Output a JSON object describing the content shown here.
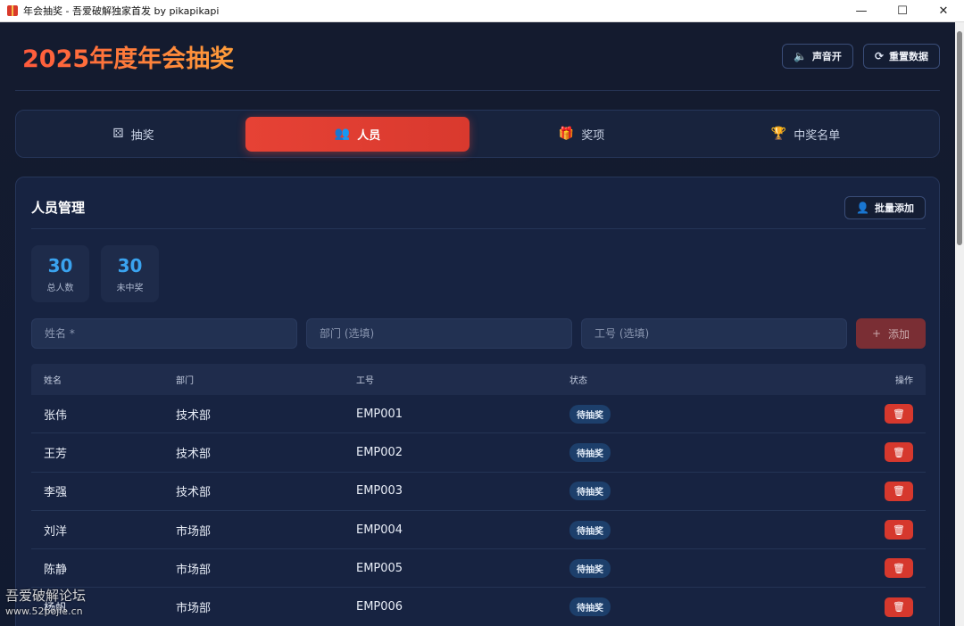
{
  "window": {
    "title": "年会抽奖 - 吾爱破解独家首发 by pikapikapi",
    "minimize": "—",
    "maximize": "☐",
    "close": "✕"
  },
  "header": {
    "title": "2025年度年会抽奖",
    "sound_button": "声音开",
    "reset_button": "重置数据"
  },
  "tabs": [
    {
      "label": "抽奖",
      "icon": "dice-icon",
      "active": false
    },
    {
      "label": "人员",
      "icon": "users-icon",
      "active": true
    },
    {
      "label": "奖项",
      "icon": "gift-icon",
      "active": false
    },
    {
      "label": "中奖名单",
      "icon": "trophy-icon",
      "active": false
    }
  ],
  "panel": {
    "title": "人员管理",
    "batch_add_button": "批量添加",
    "stats": [
      {
        "value": "30",
        "label": "总人数"
      },
      {
        "value": "30",
        "label": "未中奖"
      }
    ],
    "form": {
      "name_placeholder": "姓名 *",
      "dept_placeholder": "部门 (选填)",
      "id_placeholder": "工号 (选填)",
      "add_button": "添加"
    },
    "table": {
      "headers": [
        "姓名",
        "部门",
        "工号",
        "状态",
        "操作"
      ],
      "rows": [
        {
          "name": "张伟",
          "dept": "技术部",
          "id": "EMP001",
          "status": "待抽奖"
        },
        {
          "name": "王芳",
          "dept": "技术部",
          "id": "EMP002",
          "status": "待抽奖"
        },
        {
          "name": "李强",
          "dept": "技术部",
          "id": "EMP003",
          "status": "待抽奖"
        },
        {
          "name": "刘洋",
          "dept": "市场部",
          "id": "EMP004",
          "status": "待抽奖"
        },
        {
          "name": "陈静",
          "dept": "市场部",
          "id": "EMP005",
          "status": "待抽奖"
        },
        {
          "name": "杨帆",
          "dept": "市场部",
          "id": "EMP006",
          "status": "待抽奖"
        }
      ]
    }
  },
  "watermark": {
    "name": "吾爱破解论坛",
    "url": "www.52pojie.cn"
  },
  "colors": {
    "accent": "#e64235",
    "stat_number": "#3aa3ef",
    "background": "#121a2e"
  }
}
